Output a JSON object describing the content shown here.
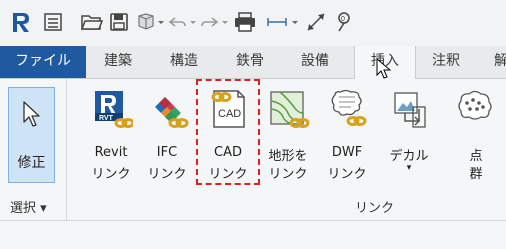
{
  "quick_access": {
    "icons": [
      "revit-logo-icon",
      "info-center-icon",
      "open-folder-icon",
      "save-icon",
      "sync-icon",
      "undo-icon",
      "redo-icon",
      "print-icon",
      "measure-icon",
      "dimension-icon",
      "tag-icon"
    ]
  },
  "tabs": [
    {
      "label": "ファイル",
      "name": "tab-file"
    },
    {
      "label": "建築",
      "name": "tab-architecture"
    },
    {
      "label": "構造",
      "name": "tab-structure"
    },
    {
      "label": "鉄骨",
      "name": "tab-steel"
    },
    {
      "label": "設備",
      "name": "tab-systems"
    },
    {
      "label": "挿入",
      "name": "tab-insert"
    },
    {
      "label": "注釈",
      "name": "tab-annotate"
    },
    {
      "label": "解",
      "name": "tab-analyze"
    }
  ],
  "ribbon": {
    "select_panel": {
      "modify_label": "修正",
      "panel_label": "選択 ▾"
    },
    "link_panel": {
      "panel_label": "リンク",
      "tools": [
        {
          "line1": "Revit",
          "line2": "リンク",
          "icon": "revit-link-icon",
          "badge": "RVT"
        },
        {
          "line1": "IFC",
          "line2": "リンク",
          "icon": "ifc-link-icon"
        },
        {
          "line1": "CAD",
          "line2": "リンク",
          "icon": "cad-link-icon",
          "badge": "CAD"
        },
        {
          "line1": "地形を",
          "line2": "リンク",
          "icon": "topography-link-icon"
        },
        {
          "line1": "DWF",
          "line2": "リンク",
          "icon": "dwf-link-icon"
        },
        {
          "line1": "デカル",
          "line2": "▾",
          "icon": "decal-icon"
        },
        {
          "line1": "点",
          "line2": "群",
          "icon": "point-cloud-icon"
        }
      ]
    }
  },
  "colors": {
    "file_tab": "#1f5aa0",
    "highlight": "#e0201e",
    "revit_logo": "#1f5aa0",
    "link_chain": "#d6a21c"
  }
}
